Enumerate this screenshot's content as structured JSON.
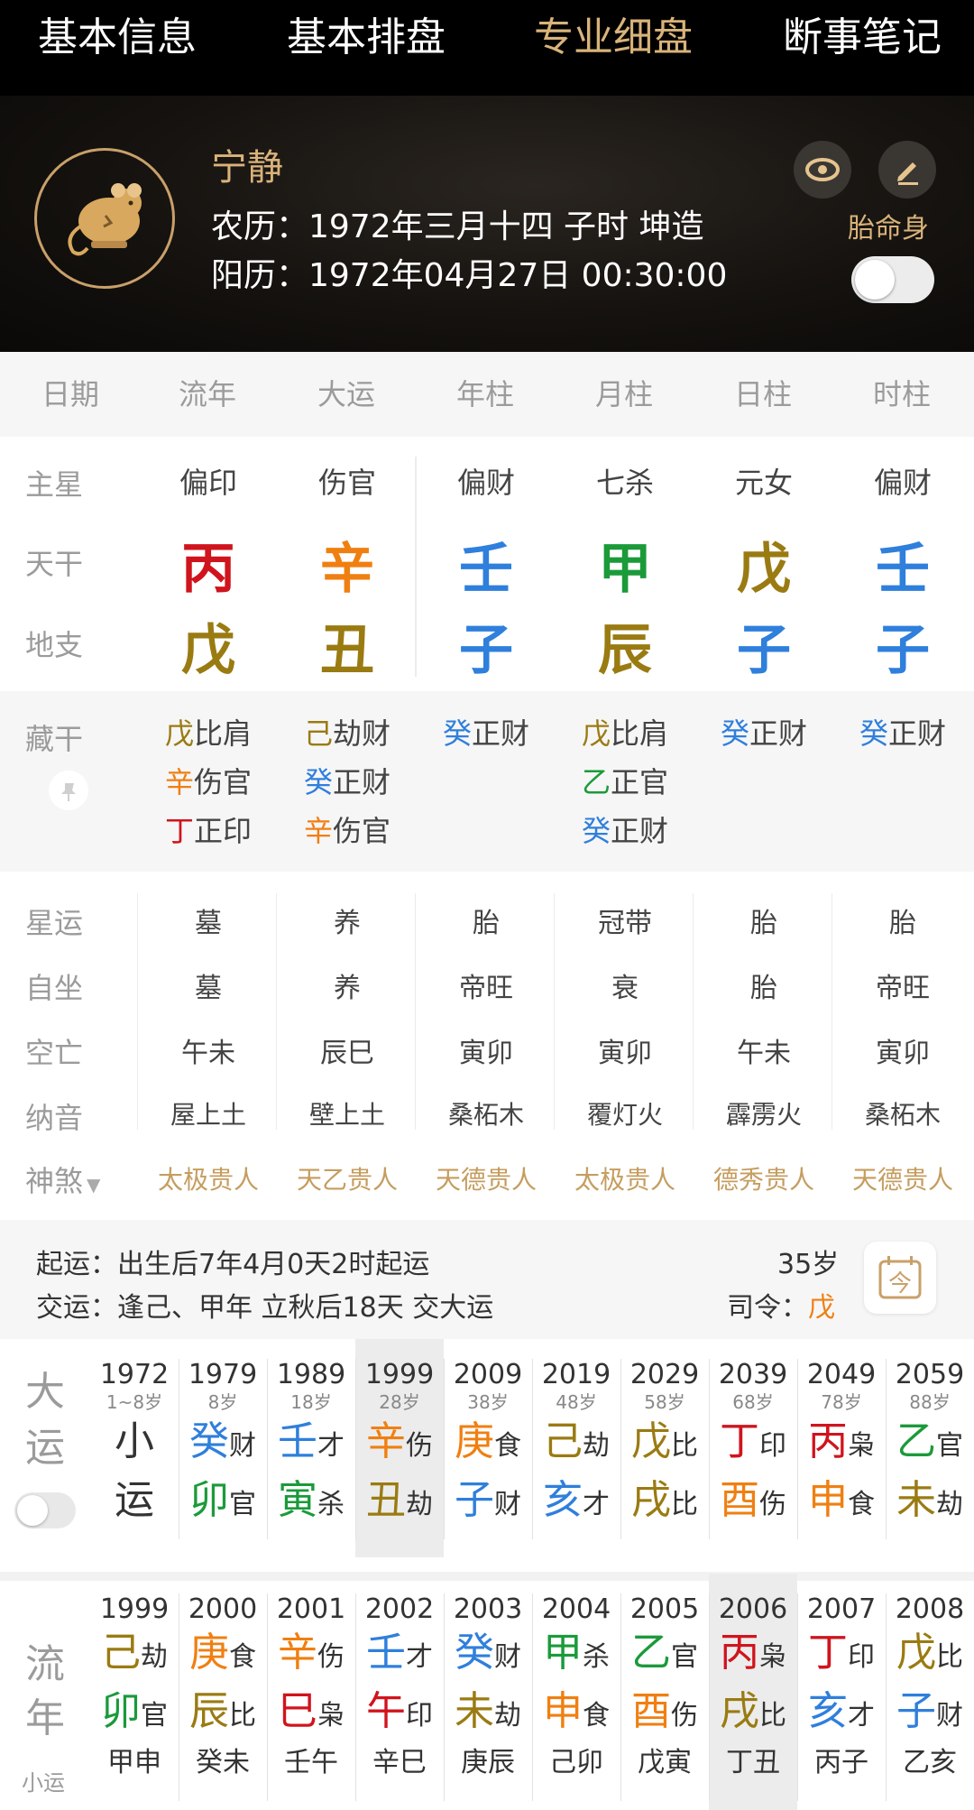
{
  "nav": {
    "tabs": [
      "基本信息",
      "基本排盘",
      "专业细盘",
      "断事笔记"
    ],
    "active_index": 2
  },
  "profile": {
    "name": "宁静",
    "lunar": "农历：1972年三月十四 子时 坤造",
    "solar": "阳历：1972年04月27日 00:30:00",
    "toggle_label": "胎命身",
    "toggle_on": false,
    "avatar_icon": "rat-zodiac-icon",
    "accent_color": "#d9b37a"
  },
  "table": {
    "headers": [
      "日期",
      "流年",
      "大运",
      "年柱",
      "月柱",
      "日柱",
      "时柱"
    ],
    "labels": {
      "star": "主星",
      "stem": "天干",
      "branch": "地支",
      "hidden": "藏干",
      "xingyun": "星运",
      "zizuo": "自坐",
      "kongwang": "空亡",
      "nayin": "纳音",
      "shensha": "神煞"
    },
    "columns": [
      {
        "star": "偏印",
        "stem": "丙",
        "stem_el": "fire",
        "branch": "戊",
        "branch_el": "earth",
        "hidden": [
          {
            "g": "戊",
            "el": "earth",
            "s": "比肩"
          },
          {
            "g": "辛",
            "el": "metal",
            "s": "伤官"
          },
          {
            "g": "丁",
            "el": "fire",
            "s": "正印"
          }
        ],
        "xingyun": "墓",
        "zizuo": "墓",
        "kongwang": "午未",
        "nayin": "屋上土",
        "shensha": "太极贵人"
      },
      {
        "star": "伤官",
        "stem": "辛",
        "stem_el": "metal",
        "branch": "丑",
        "branch_el": "earth",
        "hidden": [
          {
            "g": "己",
            "el": "earth",
            "s": "劫财"
          },
          {
            "g": "癸",
            "el": "water",
            "s": "正财"
          },
          {
            "g": "辛",
            "el": "metal",
            "s": "伤官"
          }
        ],
        "xingyun": "养",
        "zizuo": "养",
        "kongwang": "辰巳",
        "nayin": "壁上土",
        "shensha": "天乙贵人"
      },
      {
        "star": "偏财",
        "stem": "壬",
        "stem_el": "water",
        "branch": "子",
        "branch_el": "water",
        "hidden": [
          {
            "g": "癸",
            "el": "water",
            "s": "正财"
          }
        ],
        "xingyun": "胎",
        "zizuo": "帝旺",
        "kongwang": "寅卯",
        "nayin": "桑柘木",
        "shensha": "天德贵人"
      },
      {
        "star": "七杀",
        "stem": "甲",
        "stem_el": "wood",
        "branch": "辰",
        "branch_el": "earth",
        "hidden": [
          {
            "g": "戊",
            "el": "earth",
            "s": "比肩"
          },
          {
            "g": "乙",
            "el": "wood",
            "s": "正官"
          },
          {
            "g": "癸",
            "el": "water",
            "s": "正财"
          }
        ],
        "xingyun": "冠带",
        "zizuo": "衰",
        "kongwang": "寅卯",
        "nayin": "覆灯火",
        "shensha": "太极贵人"
      },
      {
        "star": "元女",
        "stem": "戊",
        "stem_el": "earth",
        "branch": "子",
        "branch_el": "water",
        "hidden": [
          {
            "g": "癸",
            "el": "water",
            "s": "正财"
          }
        ],
        "xingyun": "胎",
        "zizuo": "胎",
        "kongwang": "午未",
        "nayin": "霹雳火",
        "shensha": "德秀贵人"
      },
      {
        "star": "偏财",
        "stem": "壬",
        "stem_el": "water",
        "branch": "子",
        "branch_el": "water",
        "hidden": [
          {
            "g": "癸",
            "el": "water",
            "s": "正财"
          }
        ],
        "xingyun": "胎",
        "zizuo": "帝旺",
        "kongwang": "寅卯",
        "nayin": "桑柘木",
        "shensha": "天德贵人"
      }
    ]
  },
  "qiyun": {
    "line1_label": "起运：",
    "line1_text": "出生后7年4月0天2时起运",
    "line2_label": "交运：",
    "line2_text": "逢己、甲年 立秋后18天 交大运",
    "age": "35岁",
    "siling_label": "司令：",
    "siling_value": "戊",
    "calendar_icon": "calendar-today-icon",
    "calendar_glyph": "今"
  },
  "dayun": {
    "label_top": "大",
    "label_bottom": "运",
    "toggle_on": false,
    "highlight_index": 3,
    "items": [
      {
        "year": "1972",
        "age": "1~8岁",
        "top": "小",
        "top_el": "plain",
        "top_ss": "",
        "bot": "运",
        "bot_el": "plain",
        "bot_ss": ""
      },
      {
        "year": "1979",
        "age": "8岁",
        "top": "癸",
        "top_el": "water",
        "top_ss": "财",
        "bot": "卯",
        "bot_el": "wood",
        "bot_ss": "官"
      },
      {
        "year": "1989",
        "age": "18岁",
        "top": "壬",
        "top_el": "water",
        "top_ss": "才",
        "bot": "寅",
        "bot_el": "wood",
        "bot_ss": "杀"
      },
      {
        "year": "1999",
        "age": "28岁",
        "top": "辛",
        "top_el": "metal",
        "top_ss": "伤",
        "bot": "丑",
        "bot_el": "earth",
        "bot_ss": "劫"
      },
      {
        "year": "2009",
        "age": "38岁",
        "top": "庚",
        "top_el": "metal",
        "top_ss": "食",
        "bot": "子",
        "bot_el": "water",
        "bot_ss": "财"
      },
      {
        "year": "2019",
        "age": "48岁",
        "top": "己",
        "top_el": "earth",
        "top_ss": "劫",
        "bot": "亥",
        "bot_el": "water",
        "bot_ss": "才"
      },
      {
        "year": "2029",
        "age": "58岁",
        "top": "戊",
        "top_el": "earth",
        "top_ss": "比",
        "bot": "戌",
        "bot_el": "earth",
        "bot_ss": "比"
      },
      {
        "year": "2039",
        "age": "68岁",
        "top": "丁",
        "top_el": "fire",
        "top_ss": "印",
        "bot": "酉",
        "bot_el": "metal",
        "bot_ss": "伤"
      },
      {
        "year": "2049",
        "age": "78岁",
        "top": "丙",
        "top_el": "fire",
        "top_ss": "枭",
        "bot": "申",
        "bot_el": "metal",
        "bot_ss": "食"
      },
      {
        "year": "2059",
        "age": "88岁",
        "top": "乙",
        "top_el": "wood",
        "top_ss": "官",
        "bot": "未",
        "bot_el": "earth",
        "bot_ss": "劫"
      }
    ]
  },
  "liunian": {
    "label_top": "流",
    "label_bottom": "年",
    "label_small": "小运",
    "highlight_index": 7,
    "items": [
      {
        "year": "1999",
        "top": "己",
        "top_el": "earth",
        "top_ss": "劫",
        "bot": "卯",
        "bot_el": "wood",
        "bot_ss": "官",
        "xy": "甲申"
      },
      {
        "year": "2000",
        "top": "庚",
        "top_el": "metal",
        "top_ss": "食",
        "bot": "辰",
        "bot_el": "earth",
        "bot_ss": "比",
        "xy": "癸未"
      },
      {
        "year": "2001",
        "top": "辛",
        "top_el": "metal",
        "top_ss": "伤",
        "bot": "巳",
        "bot_el": "fire",
        "bot_ss": "枭",
        "xy": "壬午"
      },
      {
        "year": "2002",
        "top": "壬",
        "top_el": "water",
        "top_ss": "才",
        "bot": "午",
        "bot_el": "fire",
        "bot_ss": "印",
        "xy": "辛巳"
      },
      {
        "year": "2003",
        "top": "癸",
        "top_el": "water",
        "top_ss": "财",
        "bot": "未",
        "bot_el": "earth",
        "bot_ss": "劫",
        "xy": "庚辰"
      },
      {
        "year": "2004",
        "top": "甲",
        "top_el": "wood",
        "top_ss": "杀",
        "bot": "申",
        "bot_el": "metal",
        "bot_ss": "食",
        "xy": "己卯"
      },
      {
        "year": "2005",
        "top": "乙",
        "top_el": "wood",
        "top_ss": "官",
        "bot": "酉",
        "bot_el": "metal",
        "bot_ss": "伤",
        "xy": "戊寅"
      },
      {
        "year": "2006",
        "top": "丙",
        "top_el": "fire",
        "top_ss": "枭",
        "bot": "戌",
        "bot_el": "earth",
        "bot_ss": "比",
        "xy": "丁丑"
      },
      {
        "year": "2007",
        "top": "丁",
        "top_el": "fire",
        "top_ss": "印",
        "bot": "亥",
        "bot_el": "water",
        "bot_ss": "才",
        "xy": "丙子"
      },
      {
        "year": "2008",
        "top": "戊",
        "top_el": "earth",
        "top_ss": "比",
        "bot": "子",
        "bot_el": "water",
        "bot_ss": "财",
        "xy": "乙亥"
      }
    ]
  },
  "element_colors": {
    "fire": "#d0141d",
    "metal": "#f07f11",
    "water": "#2f7fdc",
    "wood": "#1b9a3a",
    "earth": "#9a7b12",
    "plain": "#333333"
  }
}
